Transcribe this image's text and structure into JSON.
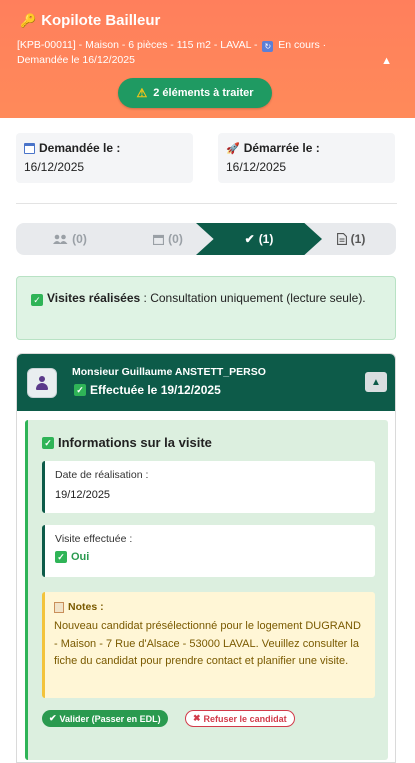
{
  "header": {
    "title": "Kopilote Bailleur",
    "meta_line1": "[KPB-00011] - Maison - 6 pièces - 115 m2 - LAVAL -",
    "status": "En cours",
    "meta_line2": "Demandée le 16/12/2025",
    "alert_label": "2 éléments à traiter",
    "collapse_glyph": "▲"
  },
  "dates": {
    "requested_label": "Demandée le :",
    "requested_value": "16/12/2025",
    "started_label": "Démarrée le :",
    "started_value": "16/12/2025"
  },
  "stepper": {
    "steps": [
      {
        "icon": "users-icon",
        "label": "(0)"
      },
      {
        "icon": "calendar-icon",
        "label": "(0)"
      },
      {
        "icon": "check-icon",
        "label": "(1)"
      },
      {
        "icon": "document-icon",
        "label": "(1)"
      }
    ],
    "active_index": 2
  },
  "banner": {
    "bold": "Visites réalisées",
    "text": " : Consultation uniquement (lecture seule)."
  },
  "visit": {
    "name": "Monsieur Guillaume ANSTETT_PERSO",
    "status": "Effectuée le 19/12/2025",
    "info_title": "Informations sur la visite",
    "date_label": "Date de réalisation :",
    "date_value": "19/12/2025",
    "done_label": "Visite effectuée :",
    "done_value": "Oui",
    "notes_label": "Notes :",
    "notes_text": "Nouveau candidat présélectionné pour le logement DUGRAND - Maison - 7 Rue d'Alsace - 53000 LAVAL. Veuillez consulter la fiche du candidat pour prendre contact et planifier une visite.",
    "validate_label": "Valider (Passer en EDL)",
    "reject_label": "Refuser le candidat"
  },
  "colors": {
    "header": "#ff7f5c",
    "accent_green": "#0d5b49",
    "success": "#2fb457",
    "danger": "#d23b4a"
  }
}
